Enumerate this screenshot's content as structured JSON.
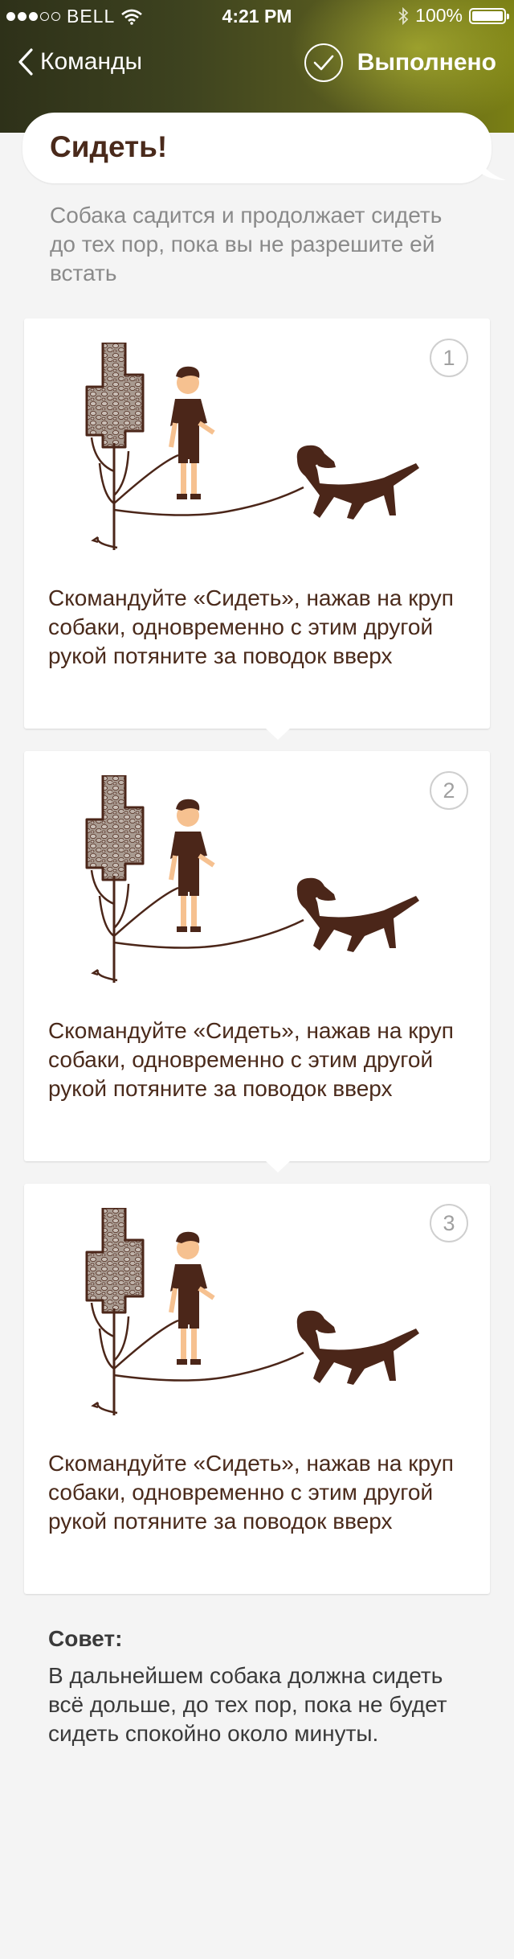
{
  "status_bar": {
    "carrier": "BELL",
    "time": "4:21 PM",
    "battery": "100%"
  },
  "nav": {
    "back_label": "Команды",
    "done_label": "Выполнено"
  },
  "title": "Сидеть!",
  "intro": "Собака садится и продолжает сидеть до тех пор, пока вы не разрешите ей встать",
  "steps": [
    {
      "number": "1",
      "text": "Скомандуйте «Сидеть», нажав на круп собаки, одновременно с этим другой рукой потяните за поводок вверх"
    },
    {
      "number": "2",
      "text": "Скомандуйте «Сидеть», нажав на круп собаки, одновременно с этим другой рукой потяните за поводок вверх"
    },
    {
      "number": "3",
      "text": "Скомандуйте «Сидеть», нажав на круп собаки, одновременно с этим другой рукой потяните за поводок вверх"
    }
  ],
  "tip": {
    "title": "Совет:",
    "text": "В дальнейшем собака должна сидеть всё дольше, до тех пор, пока не будет сидеть спокойно около минуты."
  },
  "colors": {
    "accent_brown": "#4a2a1b",
    "dog": "#4b2619",
    "tree": "#a89a90",
    "skin": "#f6c190"
  },
  "icons": {
    "back": "chevron-left-icon",
    "done": "checkmark-circle-icon",
    "wifi": "wifi-icon",
    "bluetooth": "bluetooth-icon",
    "battery": "battery-icon"
  }
}
